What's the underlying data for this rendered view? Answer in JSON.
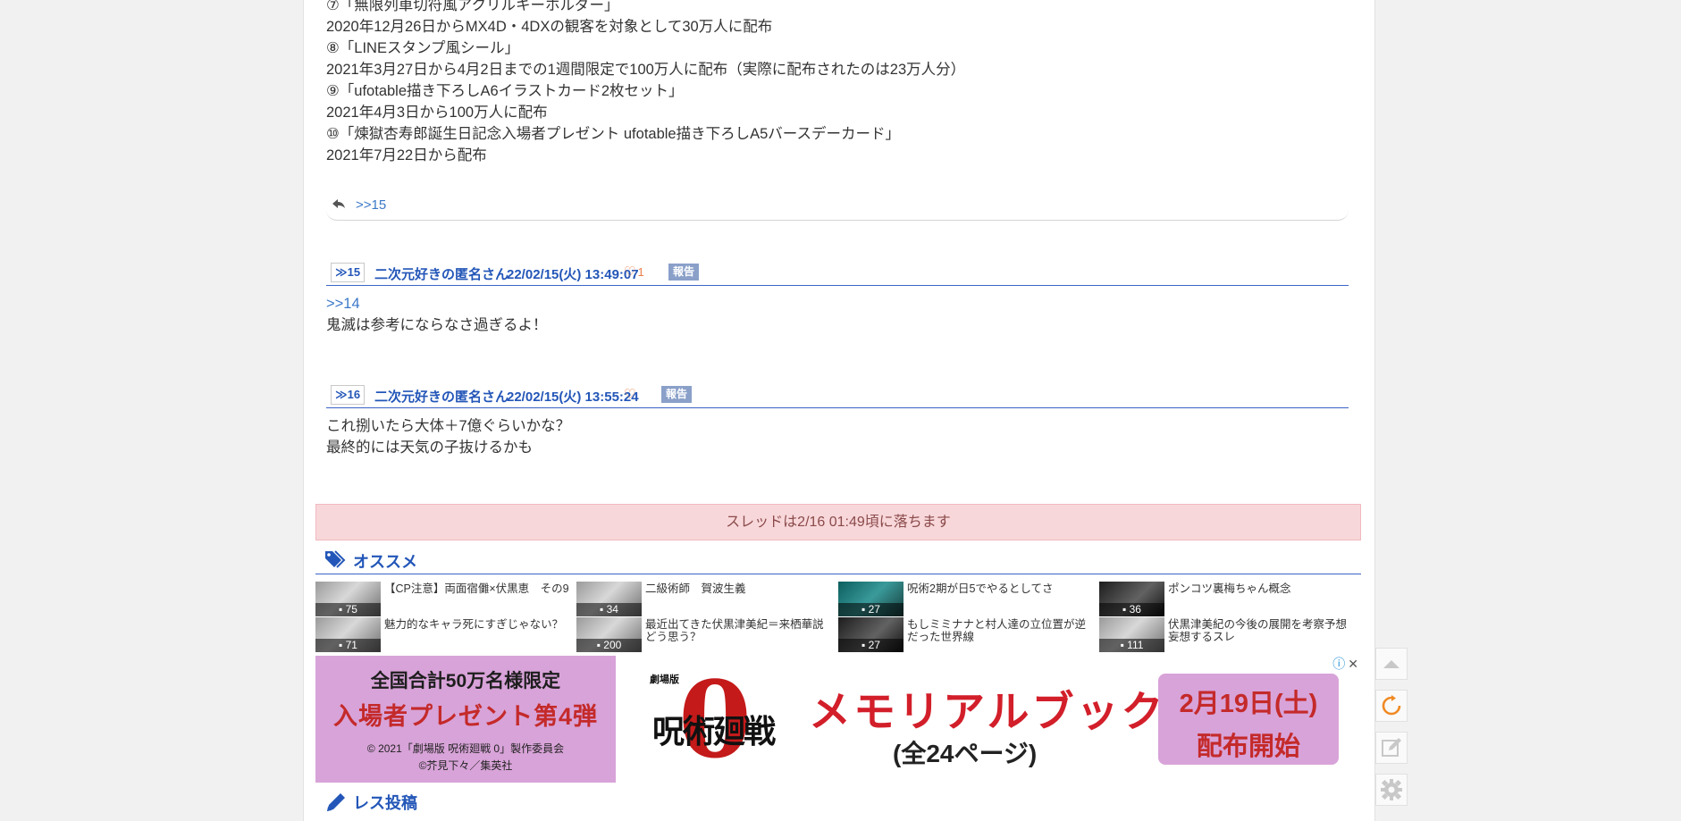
{
  "body_lines": [
    "⑦「無限列車切符風アクリルキーホルダー」",
    "2020年12月26日からMX4D・4DXの観客を対象として30万人に配布",
    "⑧「LINEスタンプ風シール」",
    "2021年3月27日から4月2日までの1週間限定で100万人に配布（実際に配布されたのは23万人分）",
    "⑨「ufotable描き下ろしA6イラストカード2枚セット」",
    "2021年4月3日から100万人に配布",
    "⑩「煉獄杏寿郎誕生日記念入場者プレゼント ufotable描き下ろしA5バースデーカード」",
    "2021年7月22日から配布"
  ],
  "reply_bar": {
    "ref": ">>15"
  },
  "posts": [
    {
      "num": "≫15",
      "name": "二次元好きの匿名さん",
      "date": "22/02/15(火) 13:49:07",
      "like": "♡",
      "like_count": "1",
      "report": "報告",
      "anchor": ">>14",
      "lines": [
        "鬼滅は参考にならなさ過ぎるよ！"
      ]
    },
    {
      "num": "≫16",
      "name": "二次元好きの匿名さん",
      "date": "22/02/15(火) 13:55:24",
      "like": "♡",
      "like_count": "",
      "report": "報告",
      "anchor": "",
      "lines": [
        "これ捌いたら大体＋7億ぐらいかな？",
        "最終的には天気の子抜けるかも"
      ]
    }
  ],
  "notice": "スレッドは2/16 01:49頃に落ちます",
  "recommend": {
    "heading": "オススメ",
    "items": [
      {
        "title": "【CP注意】両面宿儺×伏黒恵　その9",
        "count": "75"
      },
      {
        "title": "二級術師　賀波生義",
        "count": "34"
      },
      {
        "title": "呪術2期が日5でやるとしてさ",
        "count": "27"
      },
      {
        "title": "ポンコツ裏梅ちゃん概念",
        "count": "36"
      },
      {
        "title": "魅力的なキャラ死にすぎじゃない？",
        "count": "71"
      },
      {
        "title": "最近出てきた伏黒津美紀＝来栖華説どう思う？",
        "count": "200"
      },
      {
        "title": "もしミミナナと村人達の立位置が逆だった世界線",
        "count": "27"
      },
      {
        "title": "伏黒津美紀の今後の展開を考察予想妄想するスレ",
        "count": "111"
      }
    ]
  },
  "ad": {
    "left_line1": "全国合計50万名様限定",
    "left_line2": "入場者プレゼント第4弾",
    "left_line3": "© 2021「劇場版 呪術廻戦 0」製作委員会",
    "left_line4": "©芥見下々／集英社",
    "logo_small": "劇場版",
    "logo_kanji": "呪術廻戦",
    "logo_zero": "0",
    "title": "メモリアルブック",
    "pages": "(全24ページ)",
    "date": "2月19日(土)",
    "date_sub": "配布開始"
  },
  "post_form": {
    "heading": "レス投稿"
  },
  "colors": {
    "accent": "#2356b8",
    "notice_bg": "#f8d7da",
    "ad_pink": "#d8a3d8",
    "like": "#e8804a"
  }
}
